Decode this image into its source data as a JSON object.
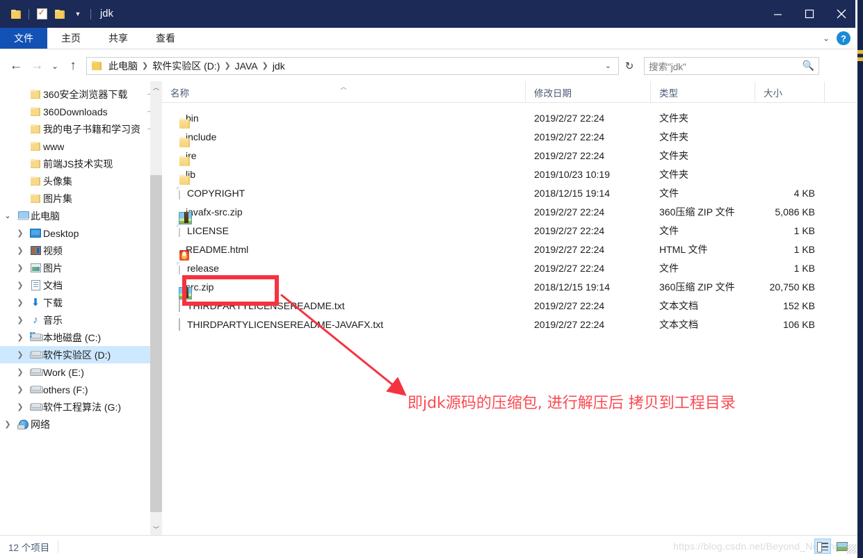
{
  "window": {
    "title": "jdk",
    "quick_access": [
      "folder-icon",
      "properties-icon",
      "new-folder-icon",
      "customize-dropdown-icon"
    ],
    "controls": {
      "minimize": "minimize-icon",
      "maximize": "maximize-icon",
      "close": "close-icon"
    }
  },
  "ribbon": {
    "tabs": [
      {
        "label": "文件",
        "active": true
      },
      {
        "label": "主页",
        "active": false
      },
      {
        "label": "共享",
        "active": false
      },
      {
        "label": "查看",
        "active": false
      }
    ],
    "expand_icon": "chevron-down-icon",
    "help_label": "?"
  },
  "toolbar": {
    "back": "arrow-left-icon",
    "forward": "arrow-right-icon",
    "recent": "chevron-down-icon",
    "up": "arrow-up-icon",
    "refresh": "refresh-icon",
    "address_dropdown": "chevron-down-icon"
  },
  "address": {
    "folder_icon": "folder-icon",
    "crumbs": [
      "此电脑",
      "软件实验区 (D:)",
      "JAVA",
      "jdk"
    ],
    "separator": "›"
  },
  "search": {
    "placeholder": "搜索\"jdk\"",
    "icon": "search-icon"
  },
  "sidebar": {
    "items": [
      {
        "label": "360安全浏览器下载",
        "icon": "folder-icon",
        "indent": 1,
        "expander": "",
        "pinned": true,
        "selected": false
      },
      {
        "label": "360Downloads",
        "icon": "folder-icon",
        "indent": 1,
        "expander": "",
        "pinned": true,
        "selected": false
      },
      {
        "label": "我的电子书籍和学习资",
        "icon": "folder-icon",
        "indent": 1,
        "expander": "",
        "pinned": true,
        "selected": false
      },
      {
        "label": "www",
        "icon": "folder-icon",
        "indent": 1,
        "expander": "",
        "pinned": false,
        "selected": false
      },
      {
        "label": "前端JS技术实现",
        "icon": "folder-icon",
        "indent": 1,
        "expander": "",
        "pinned": false,
        "selected": false
      },
      {
        "label": "头像集",
        "icon": "folder-icon",
        "indent": 1,
        "expander": "",
        "pinned": false,
        "selected": false
      },
      {
        "label": "图片集",
        "icon": "folder-icon",
        "indent": 1,
        "expander": "",
        "pinned": false,
        "selected": false
      },
      {
        "label": "此电脑",
        "icon": "this-pc-icon",
        "indent": 0,
        "expander": "v",
        "pinned": false,
        "selected": false
      },
      {
        "label": "Desktop",
        "icon": "desktop-icon",
        "indent": 1,
        "expander": ">",
        "pinned": false,
        "selected": false
      },
      {
        "label": "视频",
        "icon": "videos-icon",
        "indent": 1,
        "expander": ">",
        "pinned": false,
        "selected": false
      },
      {
        "label": "图片",
        "icon": "pictures-icon",
        "indent": 1,
        "expander": ">",
        "pinned": false,
        "selected": false
      },
      {
        "label": "文档",
        "icon": "documents-icon",
        "indent": 1,
        "expander": ">",
        "pinned": false,
        "selected": false
      },
      {
        "label": "下载",
        "icon": "downloads-icon",
        "indent": 1,
        "expander": ">",
        "pinned": false,
        "selected": false
      },
      {
        "label": "音乐",
        "icon": "music-icon",
        "indent": 1,
        "expander": ">",
        "pinned": false,
        "selected": false
      },
      {
        "label": "本地磁盘 (C:)",
        "icon": "system-drive-icon",
        "indent": 1,
        "expander": ">",
        "pinned": false,
        "selected": false
      },
      {
        "label": "软件实验区 (D:)",
        "icon": "drive-icon",
        "indent": 1,
        "expander": ">",
        "pinned": false,
        "selected": true
      },
      {
        "label": "Work (E:)",
        "icon": "drive-icon",
        "indent": 1,
        "expander": ">",
        "pinned": false,
        "selected": false
      },
      {
        "label": "others (F:)",
        "icon": "drive-icon",
        "indent": 1,
        "expander": ">",
        "pinned": false,
        "selected": false
      },
      {
        "label": "软件工程算法 (G:)",
        "icon": "drive-icon",
        "indent": 1,
        "expander": ">",
        "pinned": false,
        "selected": false
      },
      {
        "label": "网络",
        "icon": "network-icon",
        "indent": 0,
        "expander": ">",
        "pinned": false,
        "selected": false
      }
    ],
    "scrollbar": {
      "up_arrow": "chevron-up-icon",
      "down_arrow": "chevron-down-icon"
    }
  },
  "filelist": {
    "columns": [
      {
        "key": "name",
        "label": "名称",
        "sorted": true
      },
      {
        "key": "date",
        "label": "修改日期",
        "sorted": false
      },
      {
        "key": "type",
        "label": "类型",
        "sorted": false
      },
      {
        "key": "size",
        "label": "大小",
        "sorted": false
      }
    ],
    "sort_indicator": "sort-ascending-icon",
    "rows": [
      {
        "name": "bin",
        "date": "2019/2/27 22:24",
        "type": "文件夹",
        "size": "",
        "icon": "folder-icon",
        "highlighted": false
      },
      {
        "name": "include",
        "date": "2019/2/27 22:24",
        "type": "文件夹",
        "size": "",
        "icon": "folder-icon",
        "highlighted": false
      },
      {
        "name": "jre",
        "date": "2019/2/27 22:24",
        "type": "文件夹",
        "size": "",
        "icon": "folder-icon",
        "highlighted": false
      },
      {
        "name": "lib",
        "date": "2019/10/23 10:19",
        "type": "文件夹",
        "size": "",
        "icon": "folder-icon",
        "highlighted": false
      },
      {
        "name": "COPYRIGHT",
        "date": "2018/12/15 19:14",
        "type": "文件",
        "size": "4 KB",
        "icon": "file-icon",
        "highlighted": false
      },
      {
        "name": "javafx-src.zip",
        "date": "2019/2/27 22:24",
        "type": "360压缩 ZIP 文件",
        "size": "5,086 KB",
        "icon": "zip-icon",
        "highlighted": false
      },
      {
        "name": "LICENSE",
        "date": "2019/2/27 22:24",
        "type": "文件",
        "size": "1 KB",
        "icon": "file-icon",
        "highlighted": false
      },
      {
        "name": "README.html",
        "date": "2019/2/27 22:24",
        "type": "HTML 文件",
        "size": "1 KB",
        "icon": "html-icon",
        "highlighted": false
      },
      {
        "name": "release",
        "date": "2019/2/27 22:24",
        "type": "文件",
        "size": "1 KB",
        "icon": "file-icon",
        "highlighted": false
      },
      {
        "name": "src.zip",
        "date": "2018/12/15 19:14",
        "type": "360压缩 ZIP 文件",
        "size": "20,750 KB",
        "icon": "zip-icon",
        "highlighted": true
      },
      {
        "name": "THIRDPARTYLICENSEREADME.txt",
        "date": "2019/2/27 22:24",
        "type": "文本文档",
        "size": "152 KB",
        "icon": "text-icon",
        "highlighted": false
      },
      {
        "name": "THIRDPARTYLICENSEREADME-JAVAFX.txt",
        "date": "2019/2/27 22:24",
        "type": "文本文档",
        "size": "106 KB",
        "icon": "text-icon",
        "highlighted": false
      }
    ]
  },
  "annotation": {
    "text": "即jdk源码的压缩包, 进行解压后 拷贝到工程目录",
    "color": "#fb4a52",
    "box_color": "#f5333f"
  },
  "statusbar": {
    "item_count": "12 个项目",
    "watermark": "https://blog.csdn.net/Beyond_Nothing",
    "view_details": "details-view-icon",
    "view_tiles": "large-icons-view-icon"
  }
}
